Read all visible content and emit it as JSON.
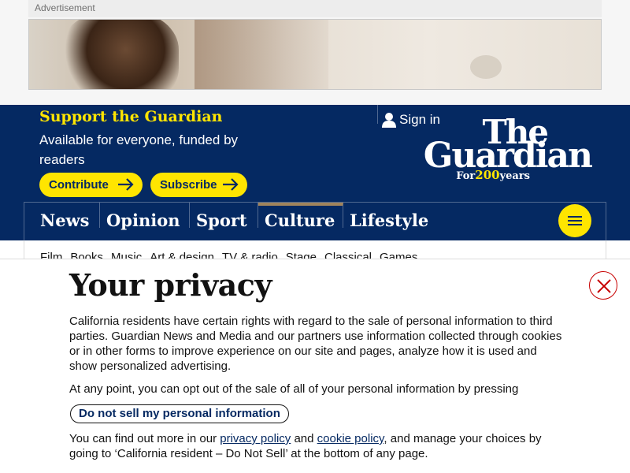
{
  "advertisement": {
    "label": "Advertisement"
  },
  "header": {
    "support_title": "Support the Guardian",
    "support_subtitle": "Available for everyone, funded by readers",
    "contribute_label": "Contribute",
    "subscribe_label": "Subscribe",
    "sign_in_label": "Sign in",
    "logo": {
      "line1": "The",
      "line2": "Guardian",
      "tagline_prefix": "For",
      "tagline_number": "200",
      "tagline_suffix": "years"
    }
  },
  "pillars": [
    {
      "label": "News"
    },
    {
      "label": "Opinion"
    },
    {
      "label": "Sport"
    },
    {
      "label": "Culture"
    },
    {
      "label": "Lifestyle"
    }
  ],
  "subnav": [
    {
      "label": "Film"
    },
    {
      "label": "Books"
    },
    {
      "label": "Music"
    },
    {
      "label": "Art & design"
    },
    {
      "label": "TV & radio"
    },
    {
      "label": "Stage"
    },
    {
      "label": "Classical"
    },
    {
      "label": "Games"
    }
  ],
  "privacy": {
    "title": "Your privacy",
    "paragraph1": "California residents have certain rights with regard to the sale of personal information to third parties. Guardian News and Media and our partners use information collected through cookies or in other forms to improve experience on our site and pages, analyze how it is used and show personalized advertising.",
    "paragraph2": "At any point, you can opt out of the sale of all of your personal information by pressing",
    "do_not_sell_label": "Do not sell my personal information",
    "p3_before": "You can find out more in our ",
    "privacy_policy_link": "privacy policy",
    "p3_and": " and ",
    "cookie_policy_link": "cookie policy",
    "p3_after": ", and manage your choices by going to ‘California resident – Do Not Sell’ at the bottom of any page."
  },
  "colors": {
    "brand_blue": "#052962",
    "brand_yellow": "#ffe500",
    "culture_accent": "#a1845c",
    "close_red": "#c70000"
  },
  "icons": [
    "user-icon",
    "arrow-right-icon",
    "hamburger-menu-icon",
    "close-icon"
  ]
}
